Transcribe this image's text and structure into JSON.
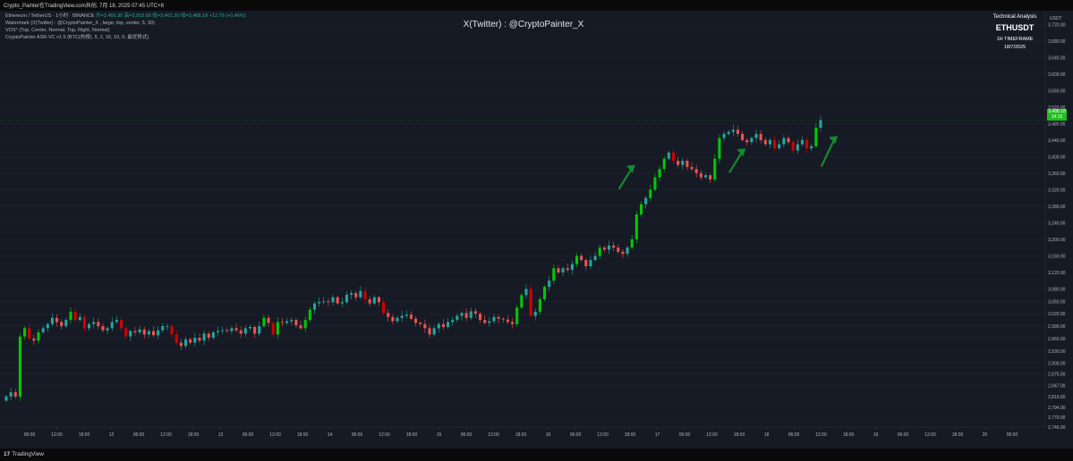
{
  "header": {
    "caption": "Crypto_Painter在TradingView.com共创, 7月 18, 2025 07:45 UTC+8"
  },
  "legend": {
    "line1_prefix": "Ethereum / TetherUS · 1小时 · BINANCE",
    "line1_ohlc": "开=3,466.30 高=3,503.66 低=3,461.30 收=3,488.18 +12.76 (+0.46%)",
    "line2": "Watermark (X(Twitter) : @CryptoPainter_X , large, top, center, 5, 30)",
    "line3": "VOS° (Top, Center, Normal, Top, Right, Normal)",
    "line4": "CryptoPainter ASR-VC v1.5 (BTC(热榜), 5, 2, 16, 10, 0, 最优移式)"
  },
  "watermark": "X(Twitter) : @CryptoPainter_X",
  "info_box": {
    "title": "Technical Analysis",
    "symbol": "ETHUSDT",
    "timeframe": "1H TIMEFRAME",
    "date": "18/7/2025"
  },
  "footer": {
    "logo_mark": "17",
    "brand": "TradingView"
  },
  "price_tag": {
    "line1": "3,488.18",
    "line2": "14:15"
  },
  "chart_data": {
    "type": "candlestick",
    "symbol": "ETHUSDT",
    "timeframe": "1H",
    "y_unit": "USDT",
    "ylim": [
      2746,
      3740
    ],
    "y_ticks": [
      3720,
      3680,
      3640,
      3600,
      3560,
      3520,
      3480,
      3440,
      3400,
      3360,
      3320,
      3280,
      3240,
      3200,
      3160,
      3120,
      3080,
      3050,
      3020,
      2990,
      2960,
      2930,
      2900,
      2875,
      2847,
      2819,
      2794,
      2770,
      2746
    ],
    "y_tick_labels": [
      "3,720.00",
      "3,680.00",
      "3,640.00",
      "3,600.00",
      "3,560.00",
      "3,520.00",
      "3,480.00",
      "3,440.00",
      "3,400.00",
      "3,360.00",
      "3,320.00",
      "3,280.00",
      "3,240.00",
      "3,200.00",
      "3,160.00",
      "3,120.00",
      "3,080.00",
      "3,050.00",
      "3,020.00",
      "2,990.00",
      "2,960.00",
      "2,930.00",
      "2,900.00",
      "2,875.00",
      "2,847.00",
      "2,819.00",
      "2,794.00",
      "2,770.00",
      "2,746.00"
    ],
    "x_ticks": [
      "06:00",
      "12:00",
      "18:00",
      "12",
      "06:00",
      "12:00",
      "18:00",
      "13",
      "06:00",
      "12:00",
      "18:00",
      "14",
      "06:00",
      "12:00",
      "18:00",
      "15",
      "06:00",
      "12:00",
      "18:00",
      "16",
      "06:00",
      "12:00",
      "18:00",
      "17",
      "06:00",
      "12:00",
      "18:00",
      "18",
      "06:00",
      "12:00",
      "18:00",
      "19",
      "06:00",
      "12:00",
      "18:00",
      "20",
      "06:00"
    ],
    "last_price": 3488.18,
    "closes": [
      2820,
      2830,
      2820,
      2965,
      2985,
      2960,
      2955,
      2975,
      2985,
      2995,
      3010,
      3000,
      2990,
      3005,
      3025,
      3005,
      3012,
      2985,
      2995,
      3000,
      2990,
      2980,
      2985,
      3000,
      3005,
      2985,
      2965,
      2978,
      2975,
      2982,
      2970,
      2978,
      2968,
      2980,
      2990,
      2990,
      2970,
      2950,
      2942,
      2958,
      2950,
      2962,
      2955,
      2972,
      2962,
      2975,
      2978,
      2980,
      2978,
      2985,
      2980,
      2972,
      2985,
      2988,
      2972,
      2990,
      3010,
      2998,
      2970,
      3000,
      2998,
      3002,
      3005,
      2992,
      2985,
      3005,
      3030,
      3045,
      3048,
      3050,
      3048,
      3060,
      3045,
      3048,
      3066,
      3070,
      3060,
      3075,
      3055,
      3045,
      3060,
      3048,
      3022,
      3012,
      3002,
      3010,
      3015,
      3018,
      3008,
      2998,
      2995,
      2985,
      2970,
      2985,
      2995,
      2988,
      3000,
      3005,
      3015,
      3022,
      3010,
      3026,
      3020,
      3005,
      2998,
      3002,
      3012,
      3008,
      3006,
      3000,
      2995,
      3035,
      3065,
      3080,
      3015,
      3025,
      3055,
      3085,
      3100,
      3130,
      3120,
      3130,
      3126,
      3140,
      3160,
      3150,
      3135,
      3150,
      3160,
      3180,
      3175,
      3185,
      3180,
      3170,
      3165,
      3180,
      3200,
      3260,
      3285,
      3300,
      3320,
      3350,
      3370,
      3395,
      3410,
      3390,
      3380,
      3390,
      3375,
      3370,
      3360,
      3350,
      3355,
      3345,
      3395,
      3445,
      3455,
      3460,
      3465,
      3455,
      3440,
      3435,
      3445,
      3455,
      3440,
      3430,
      3440,
      3420,
      3430,
      3445,
      3435,
      3415,
      3430,
      3440,
      3420,
      3425,
      3470,
      3488
    ],
    "annotations": [
      {
        "type": "arrow",
        "direction": "up-right",
        "color": "#138a2e",
        "from_price": 3340,
        "to_price": 3380
      },
      {
        "type": "arrow",
        "direction": "up-right",
        "color": "#138a2e",
        "from_price": 3380,
        "to_price": 3420
      },
      {
        "type": "arrow",
        "direction": "up-right",
        "color": "#138a2e",
        "from_price": 3395,
        "to_price": 3450
      }
    ],
    "colors": {
      "up": "#26a69a",
      "up_strong": "#00c805",
      "down": "#ef5350",
      "down_strong": "#d50000",
      "grid": "#1f2430",
      "axis_text": "#b2b5be",
      "last_price_line": "#1fbf1f"
    }
  }
}
